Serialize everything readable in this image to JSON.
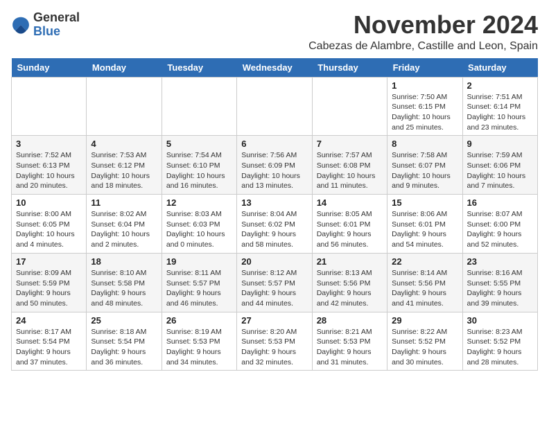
{
  "logo": {
    "general": "General",
    "blue": "Blue"
  },
  "header": {
    "month_year": "November 2024",
    "location": "Cabezas de Alambre, Castille and Leon, Spain"
  },
  "weekdays": [
    "Sunday",
    "Monday",
    "Tuesday",
    "Wednesday",
    "Thursday",
    "Friday",
    "Saturday"
  ],
  "weeks": [
    [
      {
        "day": "",
        "info": ""
      },
      {
        "day": "",
        "info": ""
      },
      {
        "day": "",
        "info": ""
      },
      {
        "day": "",
        "info": ""
      },
      {
        "day": "",
        "info": ""
      },
      {
        "day": "1",
        "info": "Sunrise: 7:50 AM\nSunset: 6:15 PM\nDaylight: 10 hours and 25 minutes."
      },
      {
        "day": "2",
        "info": "Sunrise: 7:51 AM\nSunset: 6:14 PM\nDaylight: 10 hours and 23 minutes."
      }
    ],
    [
      {
        "day": "3",
        "info": "Sunrise: 7:52 AM\nSunset: 6:13 PM\nDaylight: 10 hours and 20 minutes."
      },
      {
        "day": "4",
        "info": "Sunrise: 7:53 AM\nSunset: 6:12 PM\nDaylight: 10 hours and 18 minutes."
      },
      {
        "day": "5",
        "info": "Sunrise: 7:54 AM\nSunset: 6:10 PM\nDaylight: 10 hours and 16 minutes."
      },
      {
        "day": "6",
        "info": "Sunrise: 7:56 AM\nSunset: 6:09 PM\nDaylight: 10 hours and 13 minutes."
      },
      {
        "day": "7",
        "info": "Sunrise: 7:57 AM\nSunset: 6:08 PM\nDaylight: 10 hours and 11 minutes."
      },
      {
        "day": "8",
        "info": "Sunrise: 7:58 AM\nSunset: 6:07 PM\nDaylight: 10 hours and 9 minutes."
      },
      {
        "day": "9",
        "info": "Sunrise: 7:59 AM\nSunset: 6:06 PM\nDaylight: 10 hours and 7 minutes."
      }
    ],
    [
      {
        "day": "10",
        "info": "Sunrise: 8:00 AM\nSunset: 6:05 PM\nDaylight: 10 hours and 4 minutes."
      },
      {
        "day": "11",
        "info": "Sunrise: 8:02 AM\nSunset: 6:04 PM\nDaylight: 10 hours and 2 minutes."
      },
      {
        "day": "12",
        "info": "Sunrise: 8:03 AM\nSunset: 6:03 PM\nDaylight: 10 hours and 0 minutes."
      },
      {
        "day": "13",
        "info": "Sunrise: 8:04 AM\nSunset: 6:02 PM\nDaylight: 9 hours and 58 minutes."
      },
      {
        "day": "14",
        "info": "Sunrise: 8:05 AM\nSunset: 6:01 PM\nDaylight: 9 hours and 56 minutes."
      },
      {
        "day": "15",
        "info": "Sunrise: 8:06 AM\nSunset: 6:01 PM\nDaylight: 9 hours and 54 minutes."
      },
      {
        "day": "16",
        "info": "Sunrise: 8:07 AM\nSunset: 6:00 PM\nDaylight: 9 hours and 52 minutes."
      }
    ],
    [
      {
        "day": "17",
        "info": "Sunrise: 8:09 AM\nSunset: 5:59 PM\nDaylight: 9 hours and 50 minutes."
      },
      {
        "day": "18",
        "info": "Sunrise: 8:10 AM\nSunset: 5:58 PM\nDaylight: 9 hours and 48 minutes."
      },
      {
        "day": "19",
        "info": "Sunrise: 8:11 AM\nSunset: 5:57 PM\nDaylight: 9 hours and 46 minutes."
      },
      {
        "day": "20",
        "info": "Sunrise: 8:12 AM\nSunset: 5:57 PM\nDaylight: 9 hours and 44 minutes."
      },
      {
        "day": "21",
        "info": "Sunrise: 8:13 AM\nSunset: 5:56 PM\nDaylight: 9 hours and 42 minutes."
      },
      {
        "day": "22",
        "info": "Sunrise: 8:14 AM\nSunset: 5:56 PM\nDaylight: 9 hours and 41 minutes."
      },
      {
        "day": "23",
        "info": "Sunrise: 8:16 AM\nSunset: 5:55 PM\nDaylight: 9 hours and 39 minutes."
      }
    ],
    [
      {
        "day": "24",
        "info": "Sunrise: 8:17 AM\nSunset: 5:54 PM\nDaylight: 9 hours and 37 minutes."
      },
      {
        "day": "25",
        "info": "Sunrise: 8:18 AM\nSunset: 5:54 PM\nDaylight: 9 hours and 36 minutes."
      },
      {
        "day": "26",
        "info": "Sunrise: 8:19 AM\nSunset: 5:53 PM\nDaylight: 9 hours and 34 minutes."
      },
      {
        "day": "27",
        "info": "Sunrise: 8:20 AM\nSunset: 5:53 PM\nDaylight: 9 hours and 32 minutes."
      },
      {
        "day": "28",
        "info": "Sunrise: 8:21 AM\nSunset: 5:53 PM\nDaylight: 9 hours and 31 minutes."
      },
      {
        "day": "29",
        "info": "Sunrise: 8:22 AM\nSunset: 5:52 PM\nDaylight: 9 hours and 30 minutes."
      },
      {
        "day": "30",
        "info": "Sunrise: 8:23 AM\nSunset: 5:52 PM\nDaylight: 9 hours and 28 minutes."
      }
    ]
  ]
}
